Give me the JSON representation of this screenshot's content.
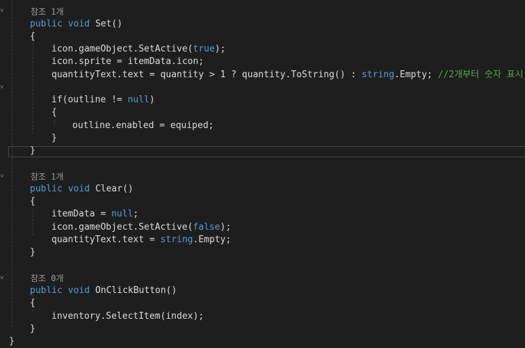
{
  "code": {
    "l0_ref": "참조 1개",
    "l1_public": "public",
    "l1_void": "void",
    "l1_name": "Set()",
    "l2": "{",
    "l3_a": "icon.gameObject.SetActive(",
    "l3_true": "true",
    "l3_b": ");",
    "l4": "icon.sprite = itemData.icon;",
    "l5_a": "quantityText.text = quantity > 1 ? quantity.ToString() : ",
    "l5_string": "string",
    "l5_b": ".Empty; ",
    "l5_comment": "//2개부터 숫자 표시",
    "l7_a": "if(outline != ",
    "l7_null": "null",
    "l7_b": ")",
    "l8": "{",
    "l9": "outline.enabled = equiped;",
    "l10": "}",
    "l11": "}",
    "l13_ref": "참조 1개",
    "l14_public": "public",
    "l14_void": "void",
    "l14_name": "Clear()",
    "l15": "{",
    "l16_a": "itemData = ",
    "l16_null": "null",
    "l16_b": ";",
    "l17_a": "icon.gameObject.SetActive(",
    "l17_false": "false",
    "l17_b": ");",
    "l18_a": "quantityText.text = ",
    "l18_string": "string",
    "l18_b": ".Empty;",
    "l19": "}",
    "l21_ref": "참조 0개",
    "l22_public": "public",
    "l22_void": "void",
    "l22_name": "OnClickButton()",
    "l23": "{",
    "l24": "inventory.SelectItem(index);",
    "l25": "}",
    "l26": "}"
  },
  "colors": {
    "background": "#1e1e1e",
    "text": "#dcdcdc",
    "keyword": "#569cd6",
    "comment": "#57a64a",
    "codelens": "#9a9a9a"
  }
}
